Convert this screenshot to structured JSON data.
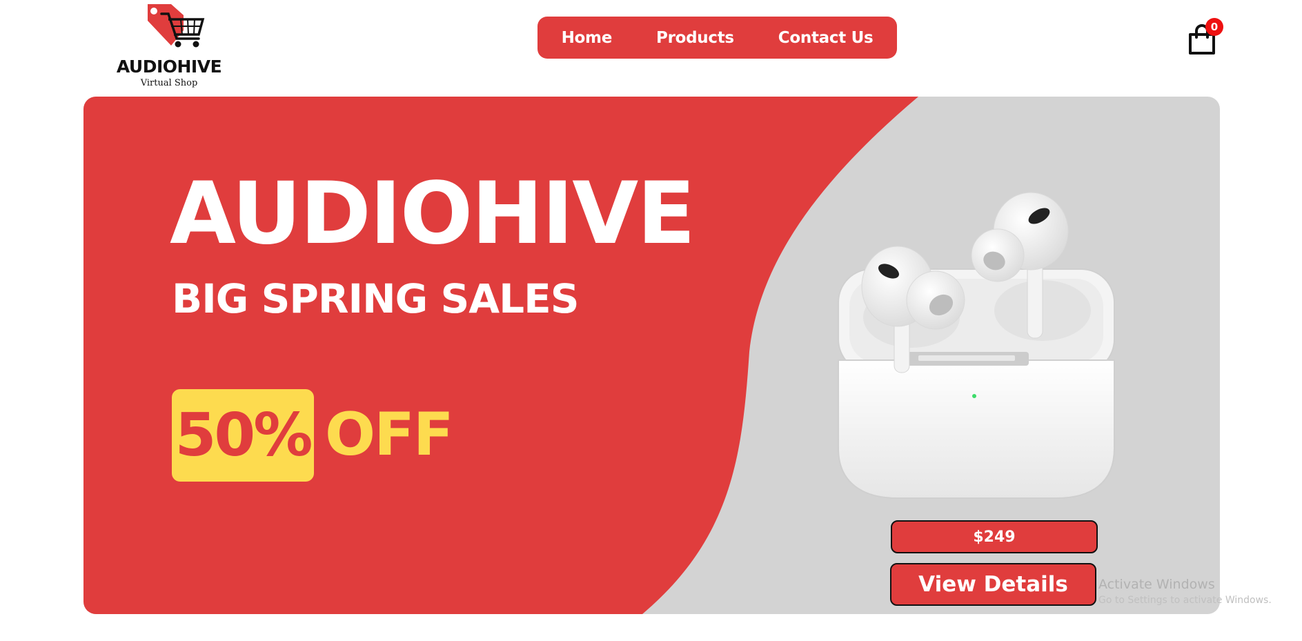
{
  "brand": {
    "name": "AUDIOHIVE",
    "tagline": "Virtual Shop",
    "logo_icon": "shopping-cart-tag-icon"
  },
  "nav": {
    "items": [
      {
        "label": "Home"
      },
      {
        "label": "Products"
      },
      {
        "label": "Contact Us"
      }
    ]
  },
  "cart": {
    "icon": "shopping-bag-icon",
    "count": "0"
  },
  "banner": {
    "headline": "AUDIOHIVE",
    "subheadline": "BIG SPRING SALES",
    "discount_value": "50%",
    "discount_suffix": "OFF",
    "price": "$249",
    "cta_label": "View Details",
    "product_image": "wireless-earbuds-with-charging-case"
  },
  "watermark": {
    "title": "Activate Windows",
    "subtitle": "Go to Settings to activate Windows."
  },
  "colors": {
    "brand_red": "#e03d3d",
    "accent_yellow": "#fddb4f",
    "banner_grey": "#d3d3d3",
    "badge_red": "#ee1111"
  }
}
